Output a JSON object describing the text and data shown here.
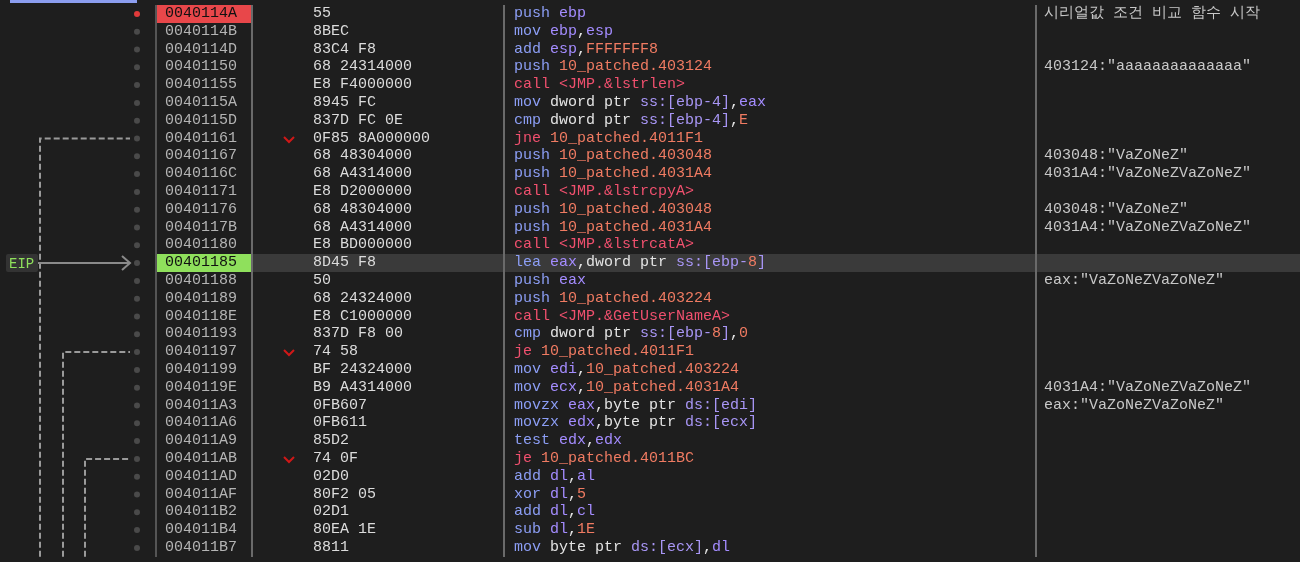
{
  "eip_label": "EIP",
  "rows": [
    {
      "address": "0040114A",
      "bytes": "55",
      "breakpoint": true,
      "current": false,
      "jump": false,
      "instruction": [
        {
          "kind": "mnemonic",
          "text": "push "
        },
        {
          "kind": "register",
          "text": "ebp"
        }
      ],
      "comment": "시리얼값 조건 비교 함수 시작"
    },
    {
      "address": "0040114B",
      "bytes": "8BEC",
      "breakpoint": false,
      "current": false,
      "jump": false,
      "instruction": [
        {
          "kind": "mnemonic",
          "text": "mov "
        },
        {
          "kind": "register",
          "text": "ebp"
        },
        {
          "kind": "plain",
          "text": ","
        },
        {
          "kind": "register",
          "text": "esp"
        }
      ]
    },
    {
      "address": "0040114D",
      "bytes": "83C4 F8",
      "breakpoint": false,
      "current": false,
      "jump": false,
      "instruction": [
        {
          "kind": "mnemonic",
          "text": "add "
        },
        {
          "kind": "register",
          "text": "esp"
        },
        {
          "kind": "plain",
          "text": ","
        },
        {
          "kind": "number",
          "text": "FFFFFFF8"
        }
      ]
    },
    {
      "address": "00401150",
      "bytes": "68 24314000",
      "breakpoint": false,
      "current": false,
      "jump": false,
      "instruction": [
        {
          "kind": "mnemonic",
          "text": "push "
        },
        {
          "kind": "number",
          "text": "10_patched.403124"
        }
      ],
      "comment": "403124:\"aaaaaaaaaaaaaa\""
    },
    {
      "address": "00401155",
      "bytes": "E8 F4000000",
      "breakpoint": false,
      "current": false,
      "jump": false,
      "instruction": [
        {
          "kind": "branch",
          "text": "call <JMP.&lstrlen>"
        }
      ]
    },
    {
      "address": "0040115A",
      "bytes": "8945 FC",
      "breakpoint": false,
      "current": false,
      "jump": false,
      "instruction": [
        {
          "kind": "mnemonic",
          "text": "mov "
        },
        {
          "kind": "plain",
          "text": "dword ptr "
        },
        {
          "kind": "segment",
          "text": "ss:[ebp-4]"
        },
        {
          "kind": "plain",
          "text": ","
        },
        {
          "kind": "register",
          "text": "eax"
        }
      ]
    },
    {
      "address": "0040115D",
      "bytes": "837D FC 0E",
      "breakpoint": false,
      "current": false,
      "jump": false,
      "instruction": [
        {
          "kind": "mnemonic",
          "text": "cmp "
        },
        {
          "kind": "plain",
          "text": "dword ptr "
        },
        {
          "kind": "segment",
          "text": "ss:[ebp-4]"
        },
        {
          "kind": "plain",
          "text": ","
        },
        {
          "kind": "number",
          "text": "E"
        }
      ]
    },
    {
      "address": "00401161",
      "bytes": "0F85 8A000000",
      "breakpoint": false,
      "current": false,
      "jump": true,
      "instruction": [
        {
          "kind": "branch",
          "text": "jne "
        },
        {
          "kind": "number",
          "text": "10_patched.4011F1"
        }
      ]
    },
    {
      "address": "00401167",
      "bytes": "68 48304000",
      "breakpoint": false,
      "current": false,
      "jump": false,
      "instruction": [
        {
          "kind": "mnemonic",
          "text": "push "
        },
        {
          "kind": "number",
          "text": "10_patched.403048"
        }
      ],
      "comment": "403048:\"VaZoNeZ\""
    },
    {
      "address": "0040116C",
      "bytes": "68 A4314000",
      "breakpoint": false,
      "current": false,
      "jump": false,
      "instruction": [
        {
          "kind": "mnemonic",
          "text": "push "
        },
        {
          "kind": "number",
          "text": "10_patched.4031A4"
        }
      ],
      "comment": "4031A4:\"VaZoNeZVaZoNeZ\""
    },
    {
      "address": "00401171",
      "bytes": "E8 D2000000",
      "breakpoint": false,
      "current": false,
      "jump": false,
      "instruction": [
        {
          "kind": "branch",
          "text": "call <JMP.&lstrcpyA>"
        }
      ]
    },
    {
      "address": "00401176",
      "bytes": "68 48304000",
      "breakpoint": false,
      "current": false,
      "jump": false,
      "instruction": [
        {
          "kind": "mnemonic",
          "text": "push "
        },
        {
          "kind": "number",
          "text": "10_patched.403048"
        }
      ],
      "comment": "403048:\"VaZoNeZ\""
    },
    {
      "address": "0040117B",
      "bytes": "68 A4314000",
      "breakpoint": false,
      "current": false,
      "jump": false,
      "instruction": [
        {
          "kind": "mnemonic",
          "text": "push "
        },
        {
          "kind": "number",
          "text": "10_patched.4031A4"
        }
      ],
      "comment": "4031A4:\"VaZoNeZVaZoNeZ\""
    },
    {
      "address": "00401180",
      "bytes": "E8 BD000000",
      "breakpoint": false,
      "current": false,
      "jump": false,
      "instruction": [
        {
          "kind": "branch",
          "text": "call <JMP.&lstrcatA>"
        }
      ]
    },
    {
      "address": "00401185",
      "bytes": "8D45 F8",
      "breakpoint": false,
      "current": true,
      "jump": false,
      "instruction": [
        {
          "kind": "mnemonic",
          "text": "lea "
        },
        {
          "kind": "register",
          "text": "eax"
        },
        {
          "kind": "plain",
          "text": ",dword ptr "
        },
        {
          "kind": "segment",
          "text": "ss:[ebp-"
        },
        {
          "kind": "number",
          "text": "8"
        },
        {
          "kind": "segment",
          "text": "]"
        }
      ]
    },
    {
      "address": "00401188",
      "bytes": "50",
      "breakpoint": false,
      "current": false,
      "jump": false,
      "instruction": [
        {
          "kind": "mnemonic",
          "text": "push "
        },
        {
          "kind": "register",
          "text": "eax"
        }
      ],
      "comment": "eax:\"VaZoNeZVaZoNeZ\""
    },
    {
      "address": "00401189",
      "bytes": "68 24324000",
      "breakpoint": false,
      "current": false,
      "jump": false,
      "instruction": [
        {
          "kind": "mnemonic",
          "text": "push "
        },
        {
          "kind": "number",
          "text": "10_patched.403224"
        }
      ]
    },
    {
      "address": "0040118E",
      "bytes": "E8 C1000000",
      "breakpoint": false,
      "current": false,
      "jump": false,
      "instruction": [
        {
          "kind": "branch",
          "text": "call <JMP.&GetUserNameA>"
        }
      ]
    },
    {
      "address": "00401193",
      "bytes": "837D F8 00",
      "breakpoint": false,
      "current": false,
      "jump": false,
      "instruction": [
        {
          "kind": "mnemonic",
          "text": "cmp "
        },
        {
          "kind": "plain",
          "text": "dword ptr "
        },
        {
          "kind": "segment",
          "text": "ss:[ebp-"
        },
        {
          "kind": "number",
          "text": "8"
        },
        {
          "kind": "segment",
          "text": "]"
        },
        {
          "kind": "plain",
          "text": ","
        },
        {
          "kind": "number",
          "text": "0"
        }
      ]
    },
    {
      "address": "00401197",
      "bytes": "74 58",
      "breakpoint": false,
      "current": false,
      "jump": true,
      "instruction": [
        {
          "kind": "branch",
          "text": "je "
        },
        {
          "kind": "number",
          "text": "10_patched.4011F1"
        }
      ]
    },
    {
      "address": "00401199",
      "bytes": "BF 24324000",
      "breakpoint": false,
      "current": false,
      "jump": false,
      "instruction": [
        {
          "kind": "mnemonic",
          "text": "mov "
        },
        {
          "kind": "register",
          "text": "edi"
        },
        {
          "kind": "plain",
          "text": ","
        },
        {
          "kind": "number",
          "text": "10_patched.403224"
        }
      ]
    },
    {
      "address": "0040119E",
      "bytes": "B9 A4314000",
      "breakpoint": false,
      "current": false,
      "jump": false,
      "instruction": [
        {
          "kind": "mnemonic",
          "text": "mov "
        },
        {
          "kind": "register",
          "text": "ecx"
        },
        {
          "kind": "plain",
          "text": ","
        },
        {
          "kind": "number",
          "text": "10_patched.4031A4"
        }
      ],
      "comment": "4031A4:\"VaZoNeZVaZoNeZ\""
    },
    {
      "address": "004011A3",
      "bytes": "0FB607",
      "breakpoint": false,
      "current": false,
      "jump": false,
      "instruction": [
        {
          "kind": "mnemonic",
          "text": "movzx "
        },
        {
          "kind": "register",
          "text": "eax"
        },
        {
          "kind": "plain",
          "text": ",byte ptr "
        },
        {
          "kind": "segment",
          "text": "ds:[edi]"
        }
      ],
      "comment": "eax:\"VaZoNeZVaZoNeZ\""
    },
    {
      "address": "004011A6",
      "bytes": "0FB611",
      "breakpoint": false,
      "current": false,
      "jump": false,
      "instruction": [
        {
          "kind": "mnemonic",
          "text": "movzx "
        },
        {
          "kind": "register",
          "text": "edx"
        },
        {
          "kind": "plain",
          "text": ",byte ptr "
        },
        {
          "kind": "segment",
          "text": "ds:[ecx]"
        }
      ]
    },
    {
      "address": "004011A9",
      "bytes": "85D2",
      "breakpoint": false,
      "current": false,
      "jump": false,
      "instruction": [
        {
          "kind": "mnemonic",
          "text": "test "
        },
        {
          "kind": "register",
          "text": "edx"
        },
        {
          "kind": "plain",
          "text": ","
        },
        {
          "kind": "register",
          "text": "edx"
        }
      ]
    },
    {
      "address": "004011AB",
      "bytes": "74 0F",
      "breakpoint": false,
      "current": false,
      "jump": true,
      "instruction": [
        {
          "kind": "branch",
          "text": "je "
        },
        {
          "kind": "number",
          "text": "10_patched.4011BC"
        }
      ]
    },
    {
      "address": "004011AD",
      "bytes": "02D0",
      "breakpoint": false,
      "current": false,
      "jump": false,
      "instruction": [
        {
          "kind": "mnemonic",
          "text": "add "
        },
        {
          "kind": "register",
          "text": "dl"
        },
        {
          "kind": "plain",
          "text": ","
        },
        {
          "kind": "register",
          "text": "al"
        }
      ]
    },
    {
      "address": "004011AF",
      "bytes": "80F2 05",
      "breakpoint": false,
      "current": false,
      "jump": false,
      "instruction": [
        {
          "kind": "mnemonic",
          "text": "xor "
        },
        {
          "kind": "register",
          "text": "dl"
        },
        {
          "kind": "plain",
          "text": ","
        },
        {
          "kind": "number",
          "text": "5"
        }
      ]
    },
    {
      "address": "004011B2",
      "bytes": "02D1",
      "breakpoint": false,
      "current": false,
      "jump": false,
      "instruction": [
        {
          "kind": "mnemonic",
          "text": "add "
        },
        {
          "kind": "register",
          "text": "dl"
        },
        {
          "kind": "plain",
          "text": ","
        },
        {
          "kind": "register",
          "text": "cl"
        }
      ]
    },
    {
      "address": "004011B4",
      "bytes": "80EA 1E",
      "breakpoint": false,
      "current": false,
      "jump": false,
      "instruction": [
        {
          "kind": "mnemonic",
          "text": "sub "
        },
        {
          "kind": "register",
          "text": "dl"
        },
        {
          "kind": "plain",
          "text": ","
        },
        {
          "kind": "number",
          "text": "1E"
        }
      ]
    },
    {
      "address": "004011B7",
      "bytes": "8811",
      "breakpoint": false,
      "current": false,
      "jump": false,
      "instruction": [
        {
          "kind": "mnemonic",
          "text": "mov "
        },
        {
          "kind": "plain",
          "text": "byte ptr "
        },
        {
          "kind": "segment",
          "text": "ds:[ecx]"
        },
        {
          "kind": "plain",
          "text": ","
        },
        {
          "kind": "register",
          "text": "dl"
        }
      ]
    }
  ]
}
